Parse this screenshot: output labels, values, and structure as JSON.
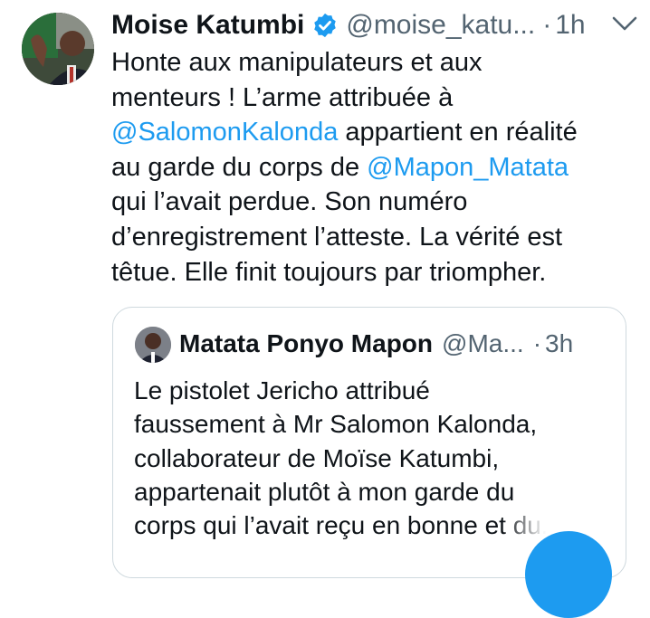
{
  "tweet": {
    "author_name": "Moise Katumbi",
    "handle": "@moise_katu...",
    "separator": "·",
    "time": "1h",
    "lines": [
      [
        {
          "text": "Honte aux manipulateurs et aux"
        }
      ],
      [
        {
          "text": "menteurs ! L’arme attribuée à"
        }
      ],
      [
        {
          "text": "@SalomonKalonda",
          "mention": true
        },
        {
          "text": " appartient en réalité"
        }
      ],
      [
        {
          "text": "au garde du corps de "
        },
        {
          "text": "@Mapon_Matata",
          "mention": true
        }
      ],
      [
        {
          "text": "qui l’avait perdue. Son numéro"
        }
      ],
      [
        {
          "text": "d’enregistrement l’atteste. La vérité est"
        }
      ],
      [
        {
          "text": "têtue. Elle finit toujours par triompher."
        }
      ]
    ],
    "icons": {
      "verified": "verified-badge-icon",
      "more": "more-options-icon",
      "compose": "compose-fab-icon"
    }
  },
  "quote": {
    "author_name": "Matata Ponyo Mapon",
    "handle": "@Ma...",
    "separator": "·",
    "time": "3h",
    "lines": [
      "Le pistolet Jericho attribué",
      "faussement à Mr Salomon Kalonda,",
      "collaborateur de Moïse Katumbi,",
      "appartenait plutôt à mon garde du",
      "corps qui l’avait reçu en bonne et du..."
    ]
  },
  "colors": {
    "text": "#0f1419",
    "muted": "#536471",
    "link": "#1d9bf0",
    "verified": "#1d9bf0",
    "border": "#cfd9de",
    "fab": "#1d9bf0"
  }
}
